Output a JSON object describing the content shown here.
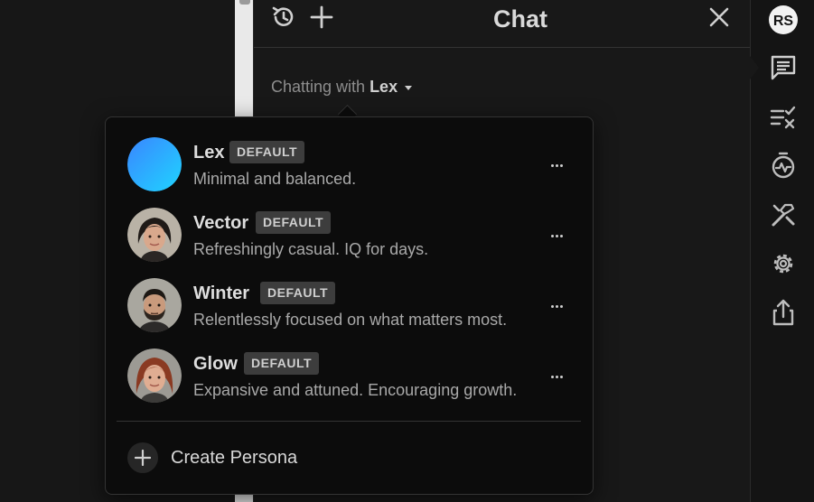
{
  "chat": {
    "title": "Chat",
    "chatting_prefix": "Chatting with",
    "current_persona": "Lex"
  },
  "personas": [
    {
      "name": "Lex",
      "badge": "DEFAULT",
      "description": "Minimal and balanced.",
      "avatar": "blue-gradient-orb"
    },
    {
      "name": "Vector",
      "badge": "DEFAULT",
      "description": "Refreshingly casual. IQ for days.",
      "avatar": "woman-short-dark-hair"
    },
    {
      "name": "Winter",
      "badge": "DEFAULT",
      "description": "Relentlessly focused on what matters most.",
      "avatar": "man-beard"
    },
    {
      "name": "Glow",
      "badge": "DEFAULT",
      "description": "Expansive and attuned. Encouraging growth.",
      "avatar": "woman-red-hair"
    }
  ],
  "create_persona_label": "Create Persona",
  "sidebar_icons": [
    "logo-icon",
    "chat-icon",
    "checklist-icon",
    "timer-icon",
    "tools-icon",
    "settings-icon",
    "share-icon"
  ],
  "colors": {
    "accent_orb_start": "#3aa0ff",
    "accent_orb_end": "#1fd0ff",
    "badge_bg": "#3d3d3d"
  }
}
